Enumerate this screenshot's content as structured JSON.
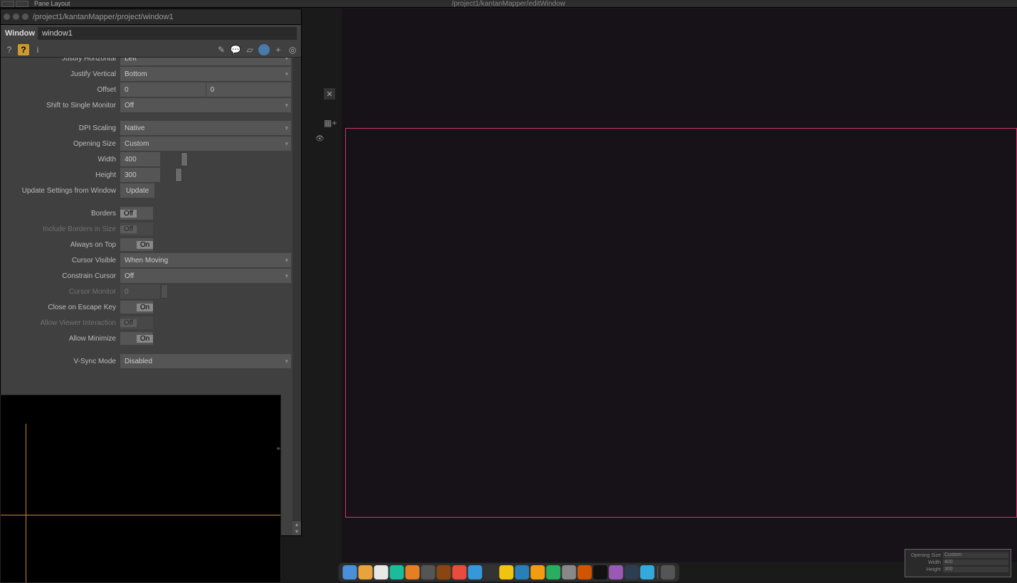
{
  "topbar": {
    "label": "Pane Layout"
  },
  "main_path": "/project1/kantanMapper/editWindow",
  "panel": {
    "path": "/project1/kantanMapper/project/window1",
    "section": "Window",
    "name": "window1"
  },
  "params": {
    "justify_h": {
      "label": "Justify Horizontal",
      "value": "Left"
    },
    "justify_v": {
      "label": "Justify Vertical",
      "value": "Bottom"
    },
    "offset": {
      "label": "Offset",
      "x": "0",
      "y": "0"
    },
    "shift_monitor": {
      "label": "Shift to Single Monitor",
      "value": "Off"
    },
    "dpi": {
      "label": "DPI Scaling",
      "value": "Native"
    },
    "opening_size": {
      "label": "Opening Size",
      "value": "Custom"
    },
    "width": {
      "label": "Width",
      "value": "400"
    },
    "height": {
      "label": "Height",
      "value": "300"
    },
    "update_settings": {
      "label": "Update Settings from Window",
      "button": "Update"
    },
    "borders": {
      "label": "Borders",
      "value": "Off"
    },
    "include_borders": {
      "label": "Include Borders in Size",
      "value": "Off"
    },
    "always_top": {
      "label": "Always on Top",
      "value": "On"
    },
    "cursor_visible": {
      "label": "Cursor Visible",
      "value": "When Moving"
    },
    "constrain_cursor": {
      "label": "Constrain Cursor",
      "value": "Off"
    },
    "cursor_monitor": {
      "label": "Cursor Monitor",
      "value": "0"
    },
    "close_escape": {
      "label": "Close on Escape Key",
      "value": "On"
    },
    "viewer_interact": {
      "label": "Allow Viewer Interaction",
      "value": "Off"
    },
    "allow_minimize": {
      "label": "Allow Minimize",
      "value": "On"
    },
    "vsync": {
      "label": "V-Sync Mode",
      "value": "Disabled"
    }
  },
  "mini": {
    "r1": {
      "l": "Opening Size",
      "v": "Custom"
    },
    "r2": {
      "l": "Width",
      "v": "400"
    },
    "r3": {
      "l": "Height",
      "v": "300"
    }
  },
  "dock_colors": [
    "#4a90d9",
    "#e8a33d",
    "#e8e8e8",
    "#1abc9c",
    "#e67e22",
    "#555",
    "#8b4513",
    "#e74c3c",
    "#3498db",
    "#333",
    "#f1c40f",
    "#2980b9",
    "#f39c12",
    "#27ae60",
    "#888",
    "#d35400",
    "#111",
    "#9b59b6",
    "#2c3e50",
    "#34aadc",
    "#555"
  ]
}
